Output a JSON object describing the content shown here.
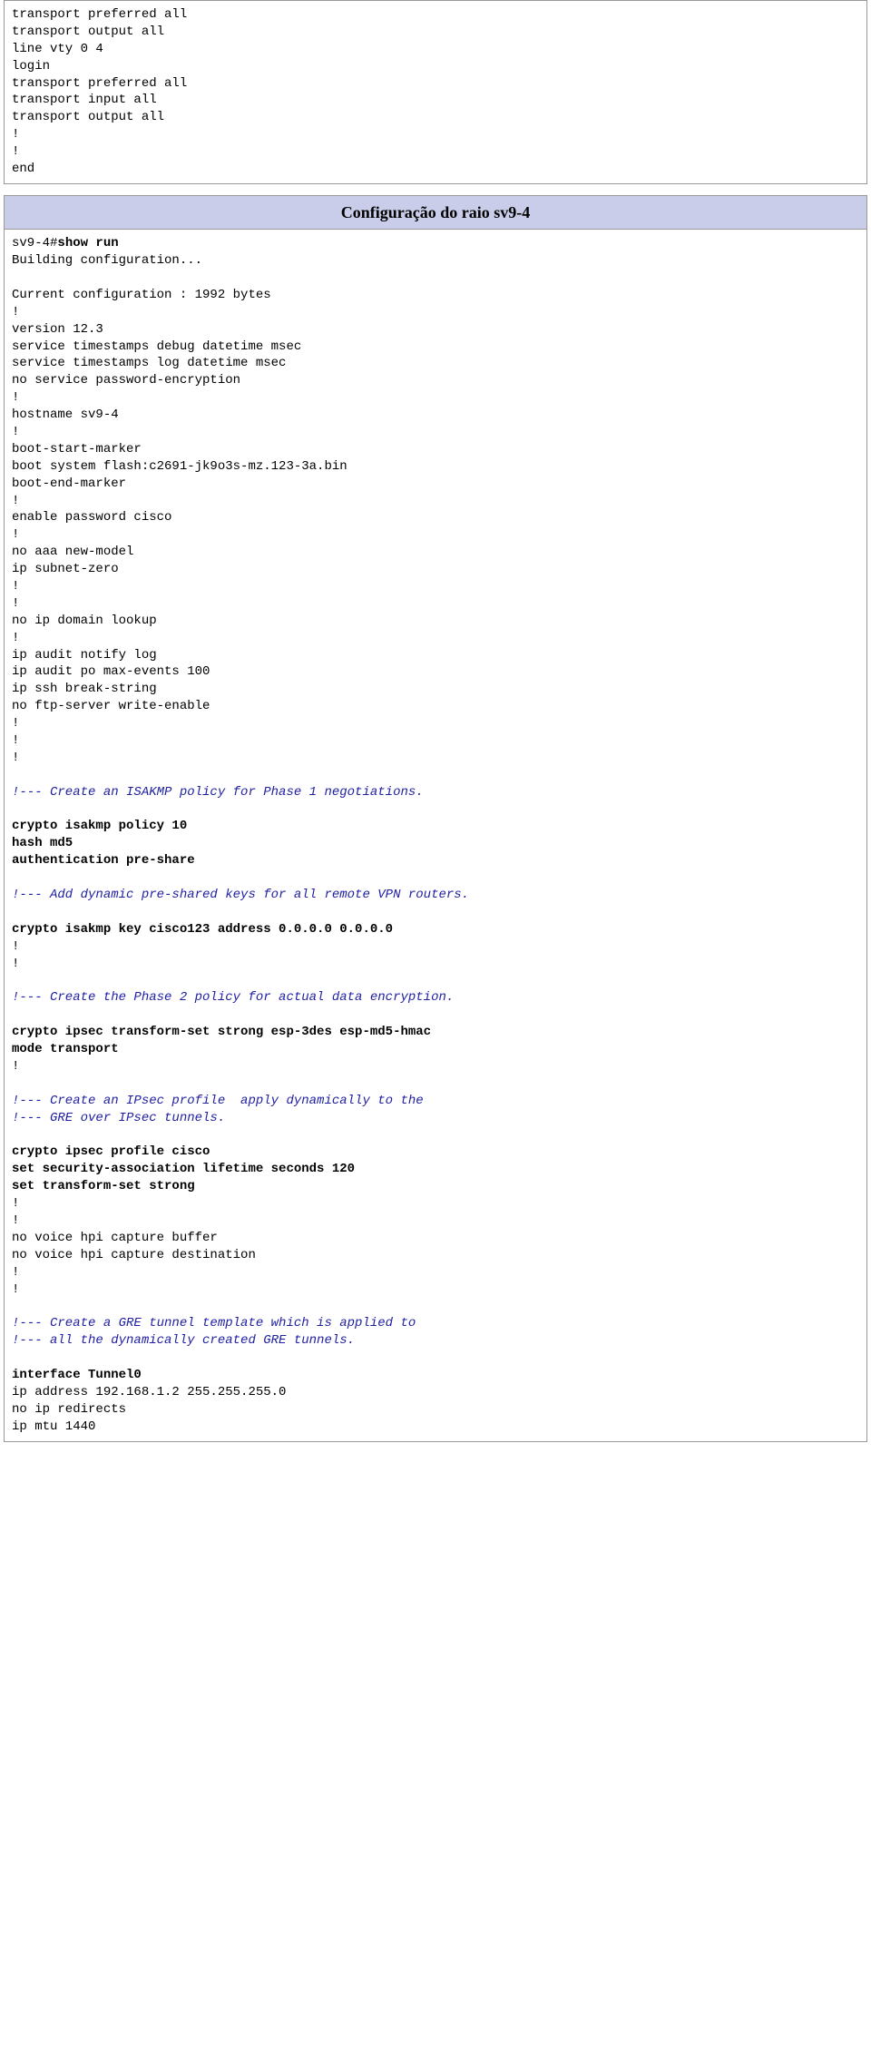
{
  "top_box": {
    "lines": [
      "transport preferred all",
      "transport output all",
      "line vty 0 4",
      "login",
      "transport preferred all",
      "transport input all",
      "transport output all",
      "!",
      "!",
      "end"
    ]
  },
  "main_box": {
    "header": "Configuração do raio sv9-4",
    "prompt": "sv9-4#",
    "cmd": "show run",
    "seg01": [
      "Building configuration...",
      "",
      "Current configuration : 1992 bytes",
      "!",
      "version 12.3",
      "service timestamps debug datetime msec",
      "service timestamps log datetime msec",
      "no service password-encryption",
      "!",
      "hostname sv9-4",
      "!",
      "boot-start-marker",
      "boot system flash:c2691-jk9o3s-mz.123-3a.bin",
      "boot-end-marker",
      "!",
      "enable password cisco",
      "!",
      "no aaa new-model",
      "ip subnet-zero",
      "!",
      "!",
      "no ip domain lookup",
      "!",
      "ip audit notify log",
      "ip audit po max-events 100",
      "ip ssh break-string",
      "no ftp-server write-enable",
      "!",
      "!",
      "!",
      ""
    ],
    "cmt01": "!--- Create an ISAKMP policy for Phase 1 negotiations.",
    "bold01": [
      "crypto isakmp policy 10",
      "hash md5",
      "authentication pre-share"
    ],
    "cmt02": "!--- Add dynamic pre-shared keys for all remote VPN routers.",
    "bold02": "crypto isakmp key cisco123 address 0.0.0.0 0.0.0.0",
    "seg02": [
      "!",
      "!",
      ""
    ],
    "cmt03": "!--- Create the Phase 2 policy for actual data encryption.",
    "bold03": [
      "crypto ipsec transform-set strong esp-3des esp-md5-hmac",
      "mode transport"
    ],
    "seg03": [
      "!",
      ""
    ],
    "cmt04a": "!--- Create an IPsec profile  apply dynamically to the",
    "cmt04b": "!--- GRE over IPsec tunnels.",
    "bold04": [
      "crypto ipsec profile cisco",
      "set security-association lifetime seconds 120",
      "set transform-set strong"
    ],
    "seg04": [
      "!",
      "!",
      "no voice hpi capture buffer",
      "no voice hpi capture destination",
      "!",
      "!",
      ""
    ],
    "cmt05a": "!--- Create a GRE tunnel template which is applied to",
    "cmt05b": "!--- all the dynamically created GRE tunnels.",
    "bold05": "interface Tunnel0",
    "seg05": [
      "ip address 192.168.1.2 255.255.255.0",
      "no ip redirects",
      "ip mtu 1440"
    ]
  }
}
